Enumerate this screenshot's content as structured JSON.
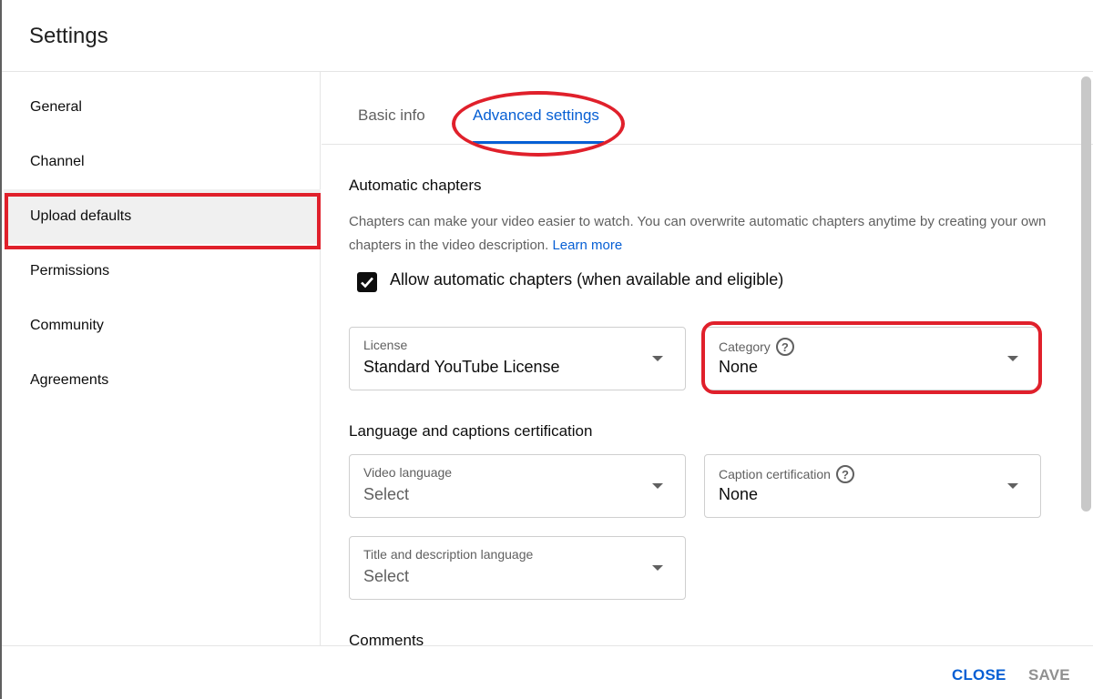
{
  "dialog": {
    "title": "Settings"
  },
  "sidebar": {
    "items": [
      {
        "label": "General",
        "active": false
      },
      {
        "label": "Channel",
        "active": false
      },
      {
        "label": "Upload defaults",
        "active": true
      },
      {
        "label": "Permissions",
        "active": false
      },
      {
        "label": "Community",
        "active": false
      },
      {
        "label": "Agreements",
        "active": false
      }
    ]
  },
  "tabs": [
    {
      "label": "Basic info",
      "active": false
    },
    {
      "label": "Advanced settings",
      "active": true
    }
  ],
  "auto_chapters": {
    "title": "Automatic chapters",
    "description": "Chapters can make your video easier to watch. You can overwrite automatic chapters anytime by creating your own chapters in the video description.",
    "learn_more": "Learn more",
    "checkbox_label": "Allow automatic chapters (when available and eligible)",
    "checked": true
  },
  "fields": {
    "license": {
      "label": "License",
      "value": "Standard YouTube License"
    },
    "category": {
      "label": "Category",
      "value": "None"
    },
    "video_language": {
      "label": "Video language",
      "value": "Select"
    },
    "caption_certification": {
      "label": "Caption certification",
      "value": "None"
    },
    "title_desc_language": {
      "label": "Title and description language",
      "value": "Select"
    }
  },
  "sections": {
    "language": "Language and captions certification",
    "comments": "Comments"
  },
  "footer": {
    "close": "CLOSE",
    "save": "SAVE"
  },
  "colors": {
    "accent": "#065fd4",
    "annotation": "#e0202b",
    "disabled": "#909090"
  }
}
